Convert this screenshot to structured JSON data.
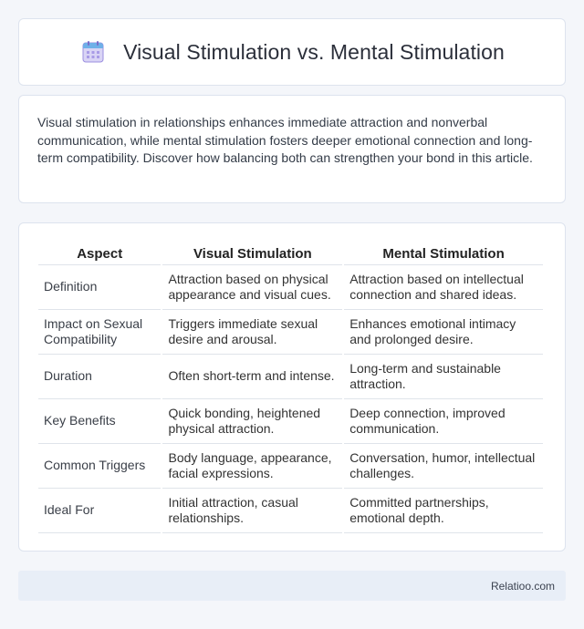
{
  "header": {
    "icon": "calendar-icon",
    "title": "Visual Stimulation vs. Mental Stimulation"
  },
  "intro": {
    "text": "Visual stimulation in relationships enhances immediate attraction and nonverbal communication, while mental stimulation fosters deeper emotional connection and long-term compatibility. Discover how balancing both can strengthen your bond in this article."
  },
  "table": {
    "headers": [
      "Aspect",
      "Visual Stimulation",
      "Mental Stimulation"
    ],
    "rows": [
      [
        "Definition",
        "Attraction based on physical appearance and visual cues.",
        "Attraction based on intellectual connection and shared ideas."
      ],
      [
        "Impact on Sexual Compatibility",
        "Triggers immediate sexual desire and arousal.",
        "Enhances emotional intimacy and prolonged desire."
      ],
      [
        "Duration",
        "Often short-term and intense.",
        "Long-term and sustainable attraction."
      ],
      [
        "Key Benefits",
        "Quick bonding, heightened physical attraction.",
        "Deep connection, improved communication."
      ],
      [
        "Common Triggers",
        "Body language, appearance, facial expressions.",
        "Conversation, humor, intellectual challenges."
      ],
      [
        "Ideal For",
        "Initial attraction, casual relationships.",
        "Committed partnerships, emotional depth."
      ]
    ]
  },
  "footer": {
    "text": "Relatioo.com"
  },
  "colors": {
    "page_bg": "#f4f6fa",
    "card_border": "#dde3ee",
    "footer_bg": "#e8eef7",
    "icon_accent": "#8a7bd8"
  }
}
